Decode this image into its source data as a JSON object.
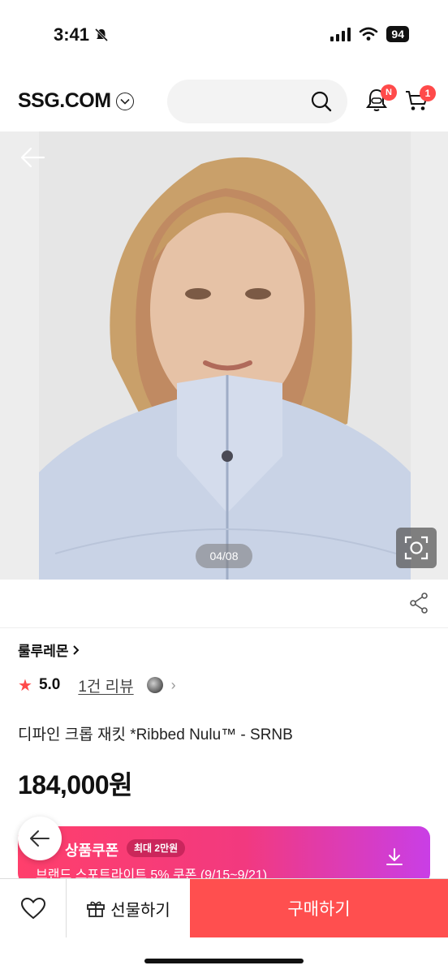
{
  "status_bar": {
    "time": "3:41",
    "battery": "94"
  },
  "header": {
    "logo": "SSG.COM",
    "notification_badge": "N",
    "cart_count": "1"
  },
  "gallery": {
    "counter": "04/08"
  },
  "product": {
    "brand": "룰루레몬",
    "rating": "5.0",
    "review_count": "1건 리뷰",
    "name": "디파인 크롭 재킷 *Ribbed Nulu™ - SRNB",
    "price": "184,000원"
  },
  "coupon": {
    "title": "상품쿠폰",
    "max_label": "최대 2만원",
    "description": "브랜드 스포트라이트 5% 쿠폰 (9/15~9/21)"
  },
  "bottom_bar": {
    "gift_label": "선물하기",
    "buy_label": "구매하기"
  },
  "colors": {
    "accent": "#ff4f4f",
    "coupon_start": "#ff3f6c",
    "coupon_end": "#c93ee6"
  }
}
